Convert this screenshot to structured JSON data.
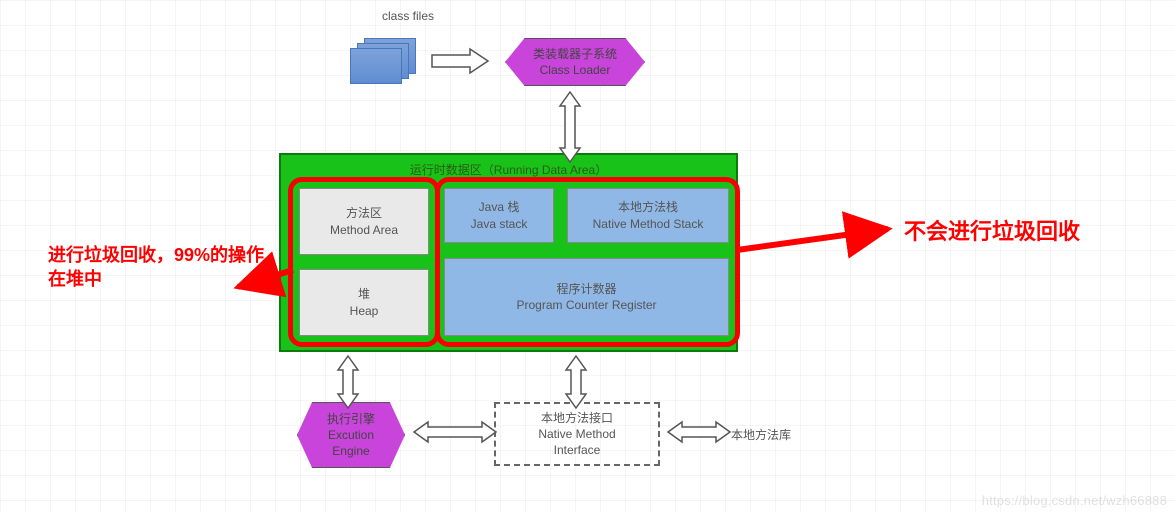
{
  "header": {
    "class_files_label": "class files"
  },
  "class_loader": {
    "l1": "类装载器子系统",
    "l2": "Class Loader"
  },
  "rda": {
    "title": "运行时数据区（Running Data Area）",
    "method_area": {
      "l1": "方法区",
      "l2": "Method Area"
    },
    "heap": {
      "l1": "堆",
      "l2": "Heap"
    },
    "java_stack": {
      "l1": "Java 栈",
      "l2": "Java stack"
    },
    "native_stack": {
      "l1": "本地方法栈",
      "l2": "Native Method Stack"
    },
    "pc_register": {
      "l1": "程序计数器",
      "l2": "Program Counter Register"
    }
  },
  "exec_engine": {
    "l1": "执行引擎",
    "l2": "Excution",
    "l3": "Engine"
  },
  "native_interface": {
    "l1": "本地方法接口",
    "l2": "Native Method",
    "l3": "Interface"
  },
  "native_lib_label": "本地方法库",
  "callouts": {
    "left_l1": "进行垃圾回收，99%的操作",
    "left_l2": "在堆中",
    "right": "不会进行垃圾回收"
  },
  "watermark": "https://blog.csdn.net/wzh66888",
  "colors": {
    "accent_red": "#ff0000",
    "hex": "#c844da",
    "rda": "#18c218",
    "blue": "#90b8e6",
    "gray": "#e9e9e9"
  }
}
